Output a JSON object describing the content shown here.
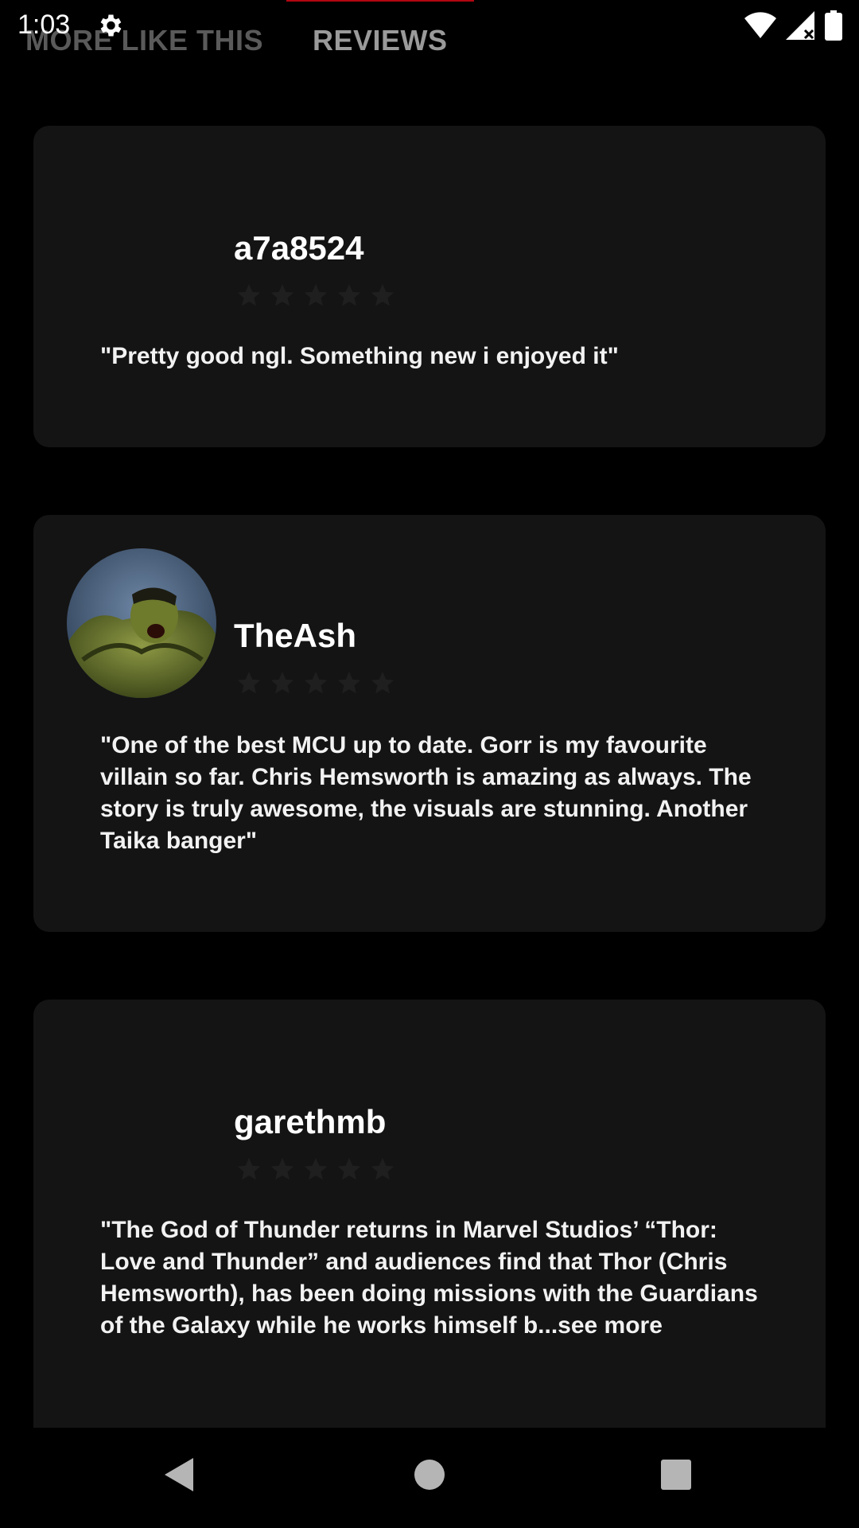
{
  "status_bar": {
    "time": "1:03"
  },
  "tabs": [
    {
      "label": "MORE LIKE THIS",
      "selected": false
    },
    {
      "label": "REVIEWS",
      "selected": true
    }
  ],
  "colors": {
    "accent": "#b20710",
    "card_bg": "#141414",
    "background": "#000000"
  },
  "reviews": [
    {
      "username": "a7a8524",
      "rating_stars": 0,
      "text": "\"Pretty good ngl. Something new i enjoyed it\"",
      "has_avatar": false
    },
    {
      "username": "TheAsh",
      "rating_stars": 0,
      "text": "\"One of the best MCU up to date. Gorr is my favourite villain so far. Chris Hemsworth is amazing as always. The story is truly awesome, the visuals are stunning. Another Taika banger\"",
      "has_avatar": true,
      "avatar_icon": "hulk-avatar"
    },
    {
      "username": "garethmb",
      "rating_stars": 0,
      "text": "\"The God of Thunder returns in Marvel Studios’ “Thor: Love and Thunder” and audiences find that Thor (Chris Hemsworth), has been doing missions with the Guardians of the Galaxy while he works himself b...see more",
      "has_avatar": false
    }
  ],
  "nav_bar": {
    "icons": [
      "back-icon",
      "home-icon",
      "recents-icon"
    ]
  }
}
